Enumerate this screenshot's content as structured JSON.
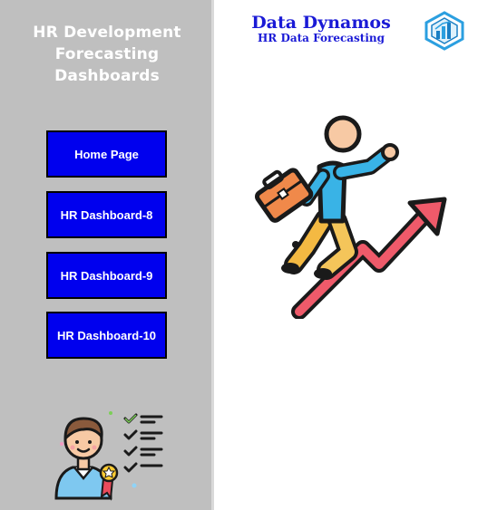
{
  "sidebar": {
    "title_line1": "HR Development",
    "title_line2": "Forecasting Dashboards",
    "buttons": [
      {
        "label": "Home Page"
      },
      {
        "label": "HR Dashboard-8"
      },
      {
        "label": "HR Dashboard-9"
      },
      {
        "label": "HR Dashboard-10"
      }
    ],
    "illustration_icon": "employee-checklist-icon"
  },
  "header": {
    "brand_name": "Data Dynamos",
    "brand_tagline": "HR Data Forecasting",
    "logo_icon": "data-dynamos-logo-icon"
  },
  "main": {
    "illustration_icon": "career-growth-icon"
  },
  "colors": {
    "sidebar_bg": "#bfbfbf",
    "button_bg": "#0000ee",
    "brand_text": "#1a1ad6",
    "logo_accent": "#2b9fe0"
  }
}
